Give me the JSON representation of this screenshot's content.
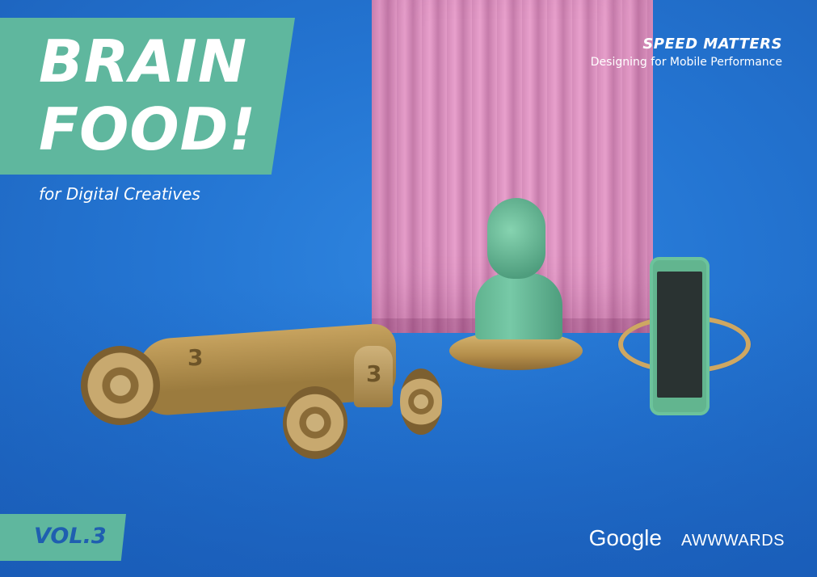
{
  "cover": {
    "title_lines": [
      "BRAIN",
      "FOOD!"
    ],
    "subtitle": "for Digital Creatives",
    "series_heading": "SPEED MATTERS",
    "series_subheading": "Designing for Mobile Performance",
    "volume": "VOL.3",
    "logos": [
      "Google",
      "AWWWARDS"
    ],
    "car_numbers": [
      "3",
      "3"
    ]
  },
  "colors": {
    "background": "#2475d2",
    "accent_teal": "#5fb79e",
    "curtain_pink": "#e39bc7",
    "gold": "#c7a35f",
    "text": "#ffffff"
  }
}
